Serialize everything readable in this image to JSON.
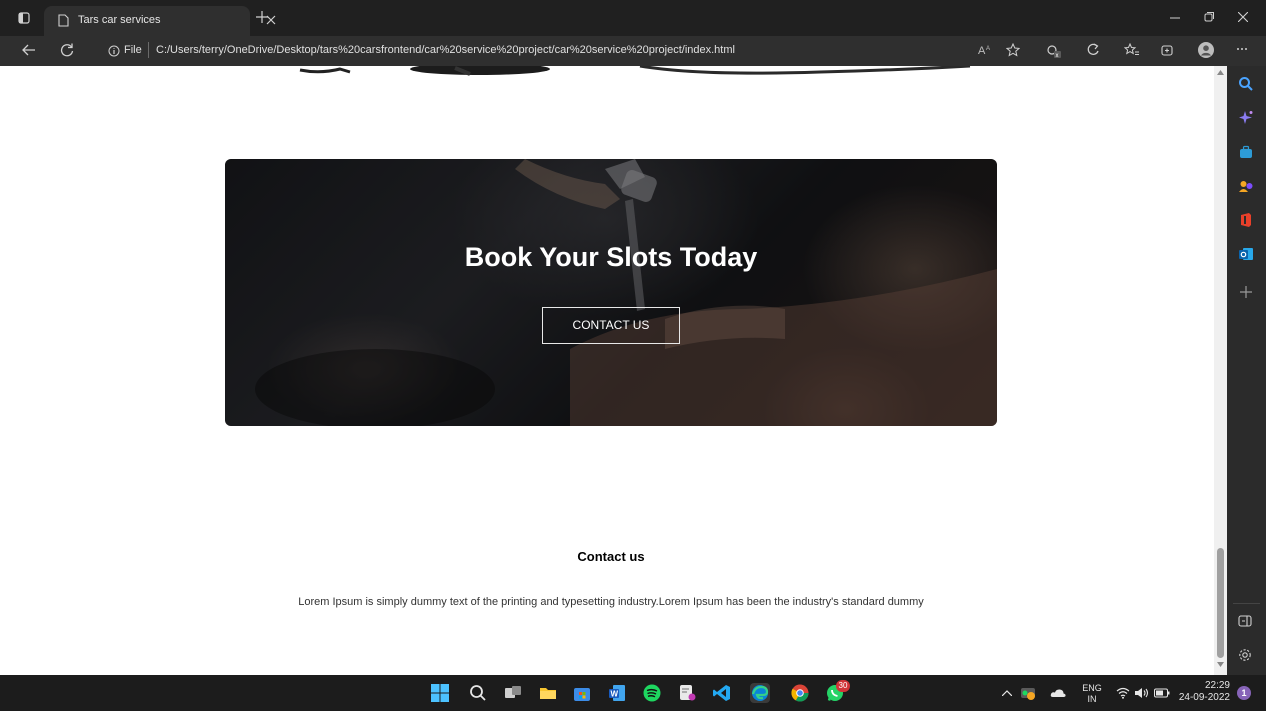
{
  "browser": {
    "tab_title": "Tars car services",
    "address_prefix": "File",
    "url": "C:/Users/terry/OneDrive/Desktop/tars%20carsfrontend/car%20service%20project/car%20service%20project/index.html"
  },
  "page": {
    "banner": {
      "title": "Book Your Slots Today",
      "button_label": "CONTACT US"
    },
    "contact": {
      "heading": "Contact us",
      "text": "Lorem Ipsum is simply dummy text of the printing and typesetting industry.Lorem Ipsum has been the industry's standard dummy"
    }
  },
  "taskbar": {
    "lang_top": "ENG",
    "lang_bottom": "IN",
    "time": "22:29",
    "date": "24-09-2022",
    "whatsapp_badge": "30",
    "notification_count": "1"
  },
  "colors": {
    "accent_edge": "#0a84d8",
    "badge_red": "#d13438",
    "notification_purple": "#8764b8"
  }
}
